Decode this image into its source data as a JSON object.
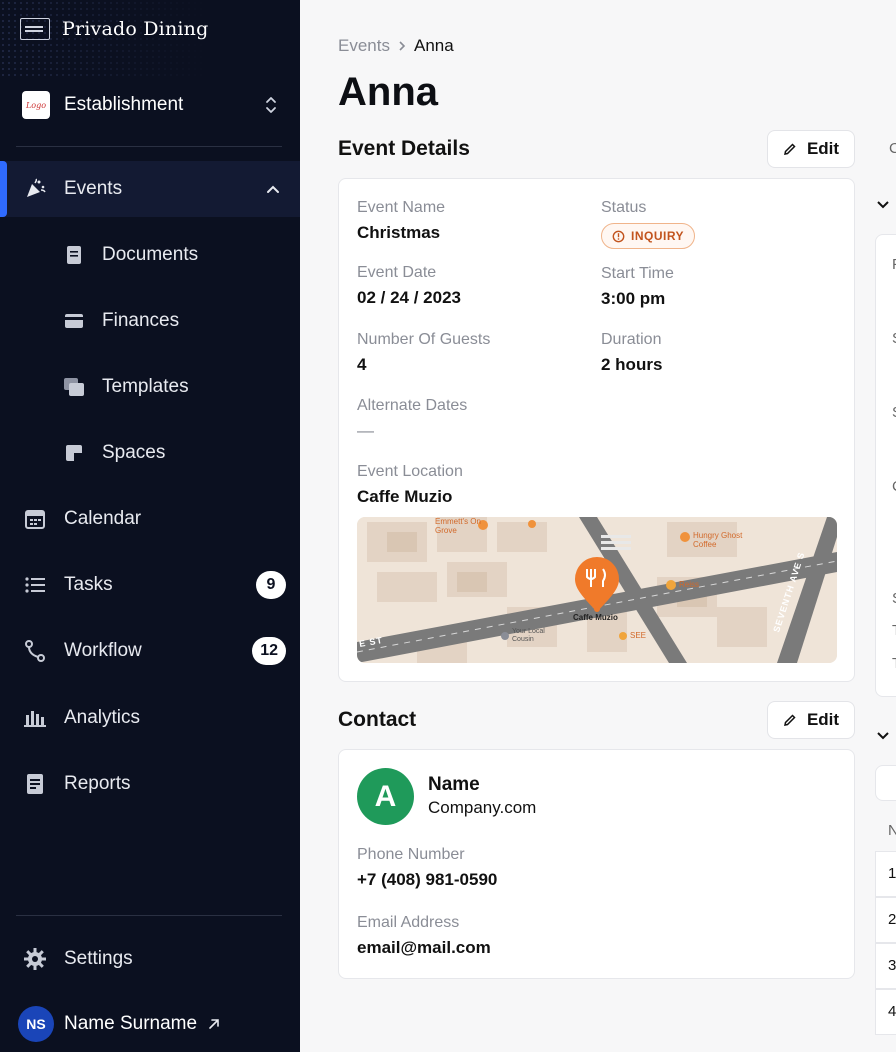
{
  "sidebar": {
    "brand": "Privado Dining",
    "establishment": {
      "label": "Establishment",
      "avatar_text": "Logo"
    },
    "nav": [
      {
        "label": "Events",
        "active": true
      },
      {
        "label": "Documents"
      },
      {
        "label": "Finances"
      },
      {
        "label": "Templates"
      },
      {
        "label": "Spaces"
      },
      {
        "label": "Calendar"
      },
      {
        "label": "Tasks",
        "badge": "9"
      },
      {
        "label": "Workflow",
        "badge": "12"
      },
      {
        "label": "Analytics"
      },
      {
        "label": "Reports"
      }
    ],
    "settings_label": "Settings",
    "user": {
      "initials": "NS",
      "name": "Name Surname"
    }
  },
  "breadcrumb": {
    "parent": "Events",
    "current": "Anna"
  },
  "page_title": "Anna",
  "event_details": {
    "title": "Event Details",
    "edit_label": "Edit",
    "event_name_label": "Event Name",
    "event_name": "Christmas",
    "status_label": "Status",
    "status": "INQUIRY",
    "event_date_label": "Event Date",
    "event_date": "02 / 24 / 2023",
    "start_time_label": "Start Time",
    "start_time": "3:00 pm",
    "guests_label": "Number Of Guests",
    "guests": "4",
    "duration_label": "Duration",
    "duration": "2 hours",
    "alternate_label": "Alternate Dates",
    "alternate": "—",
    "location_label": "Event Location",
    "location": "Caffe Muzio",
    "map": {
      "pin_label": "Caffe Muzio",
      "places": [
        "Emmett's On Grove",
        "Hungry Ghost Coffee",
        "Reiss",
        "Your Local Cousin",
        "SEE"
      ],
      "streets": [
        "SEVENTH AVE S",
        "E ST"
      ]
    }
  },
  "contact": {
    "title": "Contact",
    "edit_label": "Edit",
    "avatar_letter": "A",
    "name": "Name",
    "company": "Company.com",
    "phone_label": "Phone Number",
    "phone": "+7 (408) 981-0590",
    "email_label": "Email Address",
    "email": "email@mail.com"
  },
  "right_peek": {
    "chars": [
      "C",
      "F",
      "S",
      "S",
      "C",
      "S",
      "T",
      "T",
      "N",
      "1",
      "2",
      "3",
      "4"
    ]
  },
  "colors": {
    "sidebar_bg": "#0b1020",
    "accent": "#2f6bff",
    "status": "#c2541e",
    "avatar": "#1f9a5a"
  }
}
